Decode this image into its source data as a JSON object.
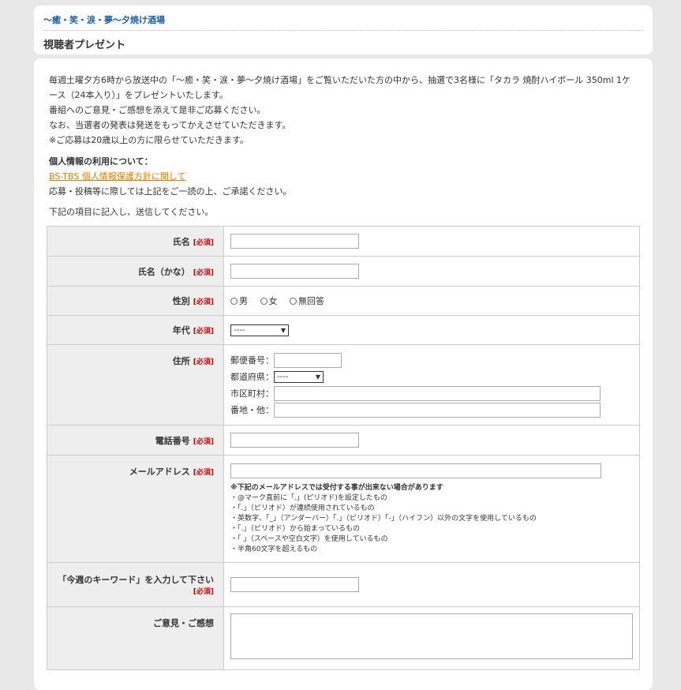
{
  "header": {
    "program_link": "〜癒・笑・涙・夢〜夕焼け酒場",
    "page_title": "視聴者プレゼント"
  },
  "intro": {
    "lines": [
      "毎週土曜夕方6時から放送中の「〜癒・笑・涙・夢〜夕焼け酒場」をご覧いただいた方の中から、抽選で3名様に「タカラ 焼酎ハイボール 350ml 1ケース（24本入り）」をプレゼントいたします。",
      "番組へのご意見・ご感想を添えて是非ご応募ください。",
      "なお、当選者の発表は発送をもってかえさせていただきます。",
      "※ご応募は20歳以上の方に限らせていただきます。"
    ]
  },
  "privacy": {
    "heading": "個人情報の利用について：",
    "link": "BS-TBS 個人情報保護方針に関して",
    "note": "応募・投稿等に際しては上記をご一読の上、ご承諾ください。"
  },
  "instruction": "下記の項目に記入し、送信してください。",
  "required_mark": "[必須]",
  "form": {
    "name_label": "氏名",
    "kana_label": "氏名（かな）",
    "gender_label": "性別",
    "gender_options": [
      "男",
      "女",
      "無回答"
    ],
    "age_label": "年代",
    "age_value": "----",
    "address_label": "住所",
    "zip_label": "郵便番号：",
    "pref_label": "都道府県：",
    "pref_value": "----",
    "city_label": "市区町村：",
    "street_label": "番地・他：",
    "phone_label": "電話番号",
    "email_label": "メールアドレス",
    "email_notes_title": "※下記のメールアドレスでは受付する事が出来ない場合があります",
    "email_notes": [
      "・@マーク直前に「.」(ピリオド)を設定したもの",
      "・「.」（ピリオド）が連続使用されているもの",
      "・英数字、「_」（アンダーバー）「.」（ピリオド）「-」（ハイフン）以外の文字を使用しているもの",
      "・「.」（ピリオド）から始まっているもの",
      "・「 」（スペースや空白文字）を使用しているもの",
      "・半角60文字を超えるもの"
    ],
    "keyword_label": "「今週のキーワード」を入力して下さい",
    "comment_label": "ご意見・ご感想"
  }
}
